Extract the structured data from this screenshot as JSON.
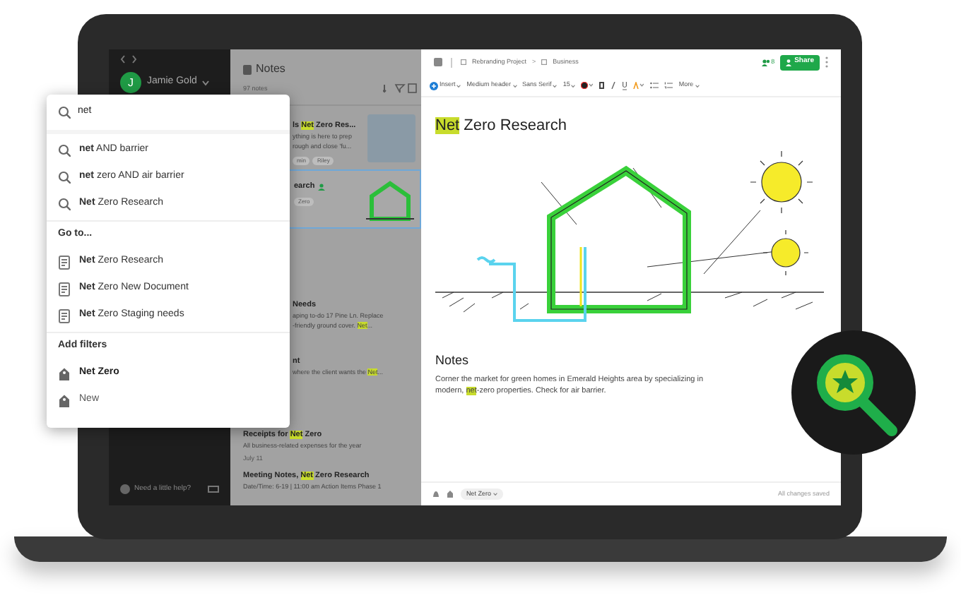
{
  "sidebar": {
    "user_initial": "J",
    "user_name": "Jamie Gold",
    "help": "Need a little help?"
  },
  "notes_list": {
    "title": "Notes",
    "count": "97 notes",
    "items": [
      {
        "title": [
          {
            "text": "ls ",
            "highlight": false
          },
          {
            "text": "Net",
            "highlight": true
          },
          {
            "text": " Zero Res...",
            "highlight": false
          }
        ],
        "snippet": [
          [
            {
              "text": "ything is here to prep",
              "highlight": false
            }
          ],
          [
            {
              "text": "rough and close 'fu...",
              "highlight": false
            }
          ]
        ],
        "tags": [
          "min",
          "Riley"
        ],
        "thumbnail": {
          "kind": "photo"
        },
        "selected": false
      },
      {
        "title": [
          {
            "text": "earch",
            "highlight": false
          }
        ],
        "shared": true,
        "tags": [
          "Zero"
        ],
        "thumbnail": {
          "kind": "sketch"
        },
        "selected": true
      },
      {
        "title": [
          {
            "text": "Needs",
            "highlight": false
          }
        ],
        "snippet": [
          [
            {
              "text": "aping to-do 17 Pine Ln. Replace",
              "highlight": false
            }
          ],
          [
            {
              "text": "-friendly ground cover. ",
              "highlight": false
            },
            {
              "text": "Net",
              "highlight": true
            },
            {
              "text": "...",
              "highlight": false
            }
          ]
        ],
        "selected": false
      },
      {
        "title": [
          {
            "text": "nt",
            "highlight": false
          }
        ],
        "snippet": [
          [
            {
              "text": "where the client wants the ",
              "highlight": false
            },
            {
              "text": "Net",
              "highlight": true
            },
            {
              "text": "...",
              "highlight": false
            }
          ]
        ],
        "selected": false
      },
      {
        "title": [
          {
            "text": "Receipts for ",
            "highlight": false
          },
          {
            "text": "Net",
            "highlight": true
          },
          {
            "text": " Zero",
            "highlight": false
          }
        ],
        "snippet": [
          [
            {
              "text": "All business-related expenses for the year",
              "highlight": false
            }
          ]
        ],
        "date": "July 11",
        "selected": false
      },
      {
        "title": [
          {
            "text": "Meeting Notes, ",
            "highlight": false
          },
          {
            "text": "Net",
            "highlight": true
          },
          {
            "text": " Zero Research",
            "highlight": false
          }
        ],
        "snippet": [
          [
            {
              "text": "Date/Time: 6-19 | 11:00 am Action Items Phase 1",
              "highlight": false
            }
          ]
        ],
        "selected": false
      }
    ]
  },
  "search": {
    "query": "net",
    "suggestions": [
      "**net** AND barrier",
      "**net** zero AND air barrier",
      "**Net** Zero Research"
    ],
    "goto": {
      "heading": "Go to...",
      "items": [
        "**Net** Zero Research",
        "**Net** Zero New Document",
        "**Net** Zero Staging needs"
      ]
    },
    "filters": {
      "heading": "Add filters",
      "items": [
        {
          "label": "Net Zero",
          "emphasized": true
        },
        {
          "label": "New",
          "emphasized": false
        }
      ]
    }
  },
  "editor": {
    "breadcrumb": [
      "Rebranding Project",
      "Business"
    ],
    "breadcrumb_separator": ">",
    "shared_count": "8",
    "share_button": "Share",
    "toolbar": [
      "Insert",
      "Medium header",
      "Sans Serif",
      "15",
      "More"
    ],
    "title": [
      {
        "text": "Net",
        "highlight": true
      },
      {
        "text": " Zero Research",
        "highlight": false
      }
    ],
    "section_heading": "Notes",
    "paragraph": [
      {
        "text": "Corner the market for green homes in Emerald Heights area by specializing in modern, ",
        "highlight": false
      },
      {
        "text": "net",
        "highlight": true
      },
      {
        "text": "-zero properties. Check for air barrier.",
        "highlight": false
      }
    ],
    "tag": "Net Zero",
    "status": "All changes saved"
  }
}
